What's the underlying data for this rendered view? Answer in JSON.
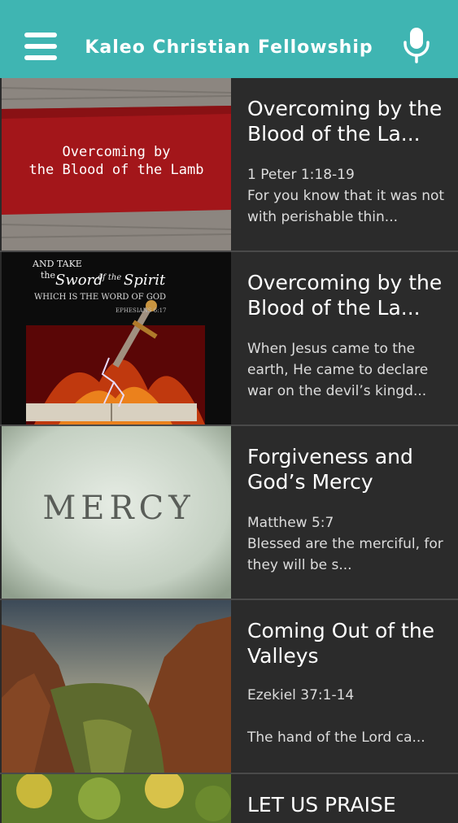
{
  "app": {
    "title": "Kaleo Christian Fellowship"
  },
  "icons": {
    "menu": "hamburger-menu-icon",
    "voice": "microphone-icon"
  },
  "colors": {
    "appbar": "#3fb5b2",
    "background": "#2b2b2b"
  },
  "sermons": [
    {
      "title": "Overcoming by the Blood of the La...",
      "description": "1 Peter 1:18-19\nFor you know that it was not with perishable thin...",
      "thumb_text": [
        "Overcoming by",
        "the Blood of the Lamb"
      ]
    },
    {
      "title": "Overcoming by the Blood of the La...",
      "description": "When Jesus came to the earth, He came to declare war on the devil’s kingd...",
      "thumb_text": [
        "AND TAKE",
        "the",
        "Sword",
        "of the",
        "Spirit",
        "WHICH IS THE WORD OF GOD",
        "EPHESIANS 6:17"
      ]
    },
    {
      "title": "Forgiveness and God’s Mercy",
      "description": "Matthew 5:7\nBlessed are the merciful, for they will be s...",
      "thumb_text": [
        "MERCY"
      ]
    },
    {
      "title": "Coming Out of the Valleys",
      "description": "Ezekiel 37:1-14\n\n The hand of the Lord ca..."
    },
    {
      "title": "LET US PRAISE"
    }
  ]
}
